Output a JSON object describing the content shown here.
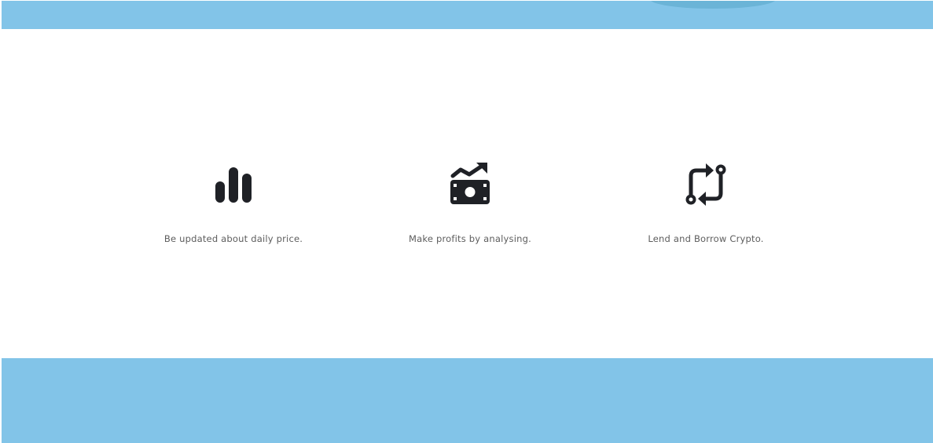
{
  "colors": {
    "band": "#82c4e8",
    "band_accent": "#5aa7c9",
    "icon": "#1f2126",
    "text": "#5d5d5d",
    "background": "#ffffff"
  },
  "features": [
    {
      "icon": "bar-chart-icon",
      "label": "Be updated about daily price."
    },
    {
      "icon": "money-trend-up-icon",
      "label": "Make profits by analysing."
    },
    {
      "icon": "exchange-arrows-icon",
      "label": "Lend and Borrow Crypto."
    }
  ]
}
